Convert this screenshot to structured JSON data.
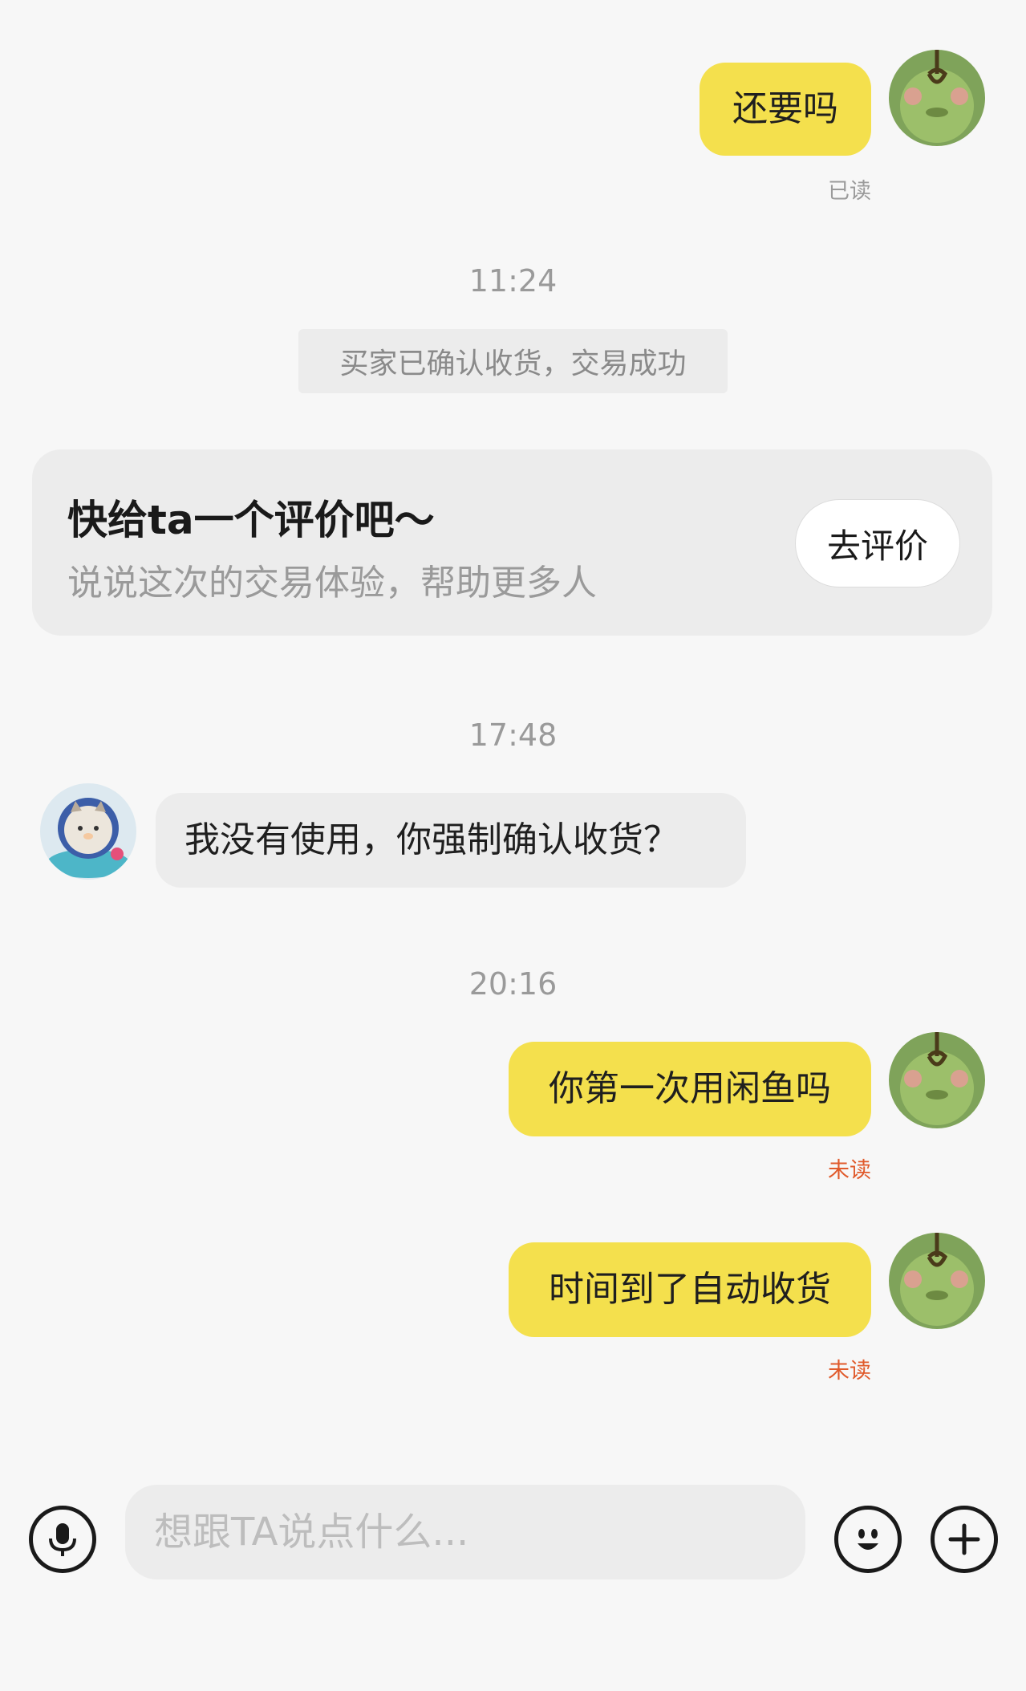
{
  "messages": [
    {
      "text": "还要吗",
      "status": "已读"
    },
    {
      "time": "11:24"
    },
    {
      "system_notice": "买家已确认收货，交易成功"
    },
    {
      "time": "17:48"
    },
    {
      "text": "我没有使用，你强制确认收货？"
    },
    {
      "time": "20:16"
    },
    {
      "text": "你第一次用闲鱼吗",
      "status": "未读"
    },
    {
      "text": "时间到了自动收货",
      "status": "未读"
    }
  ],
  "review_card": {
    "title": "快给ta一个评价吧～",
    "subtitle": "说说这次的交易体验，帮助更多人",
    "button": "去评价"
  },
  "input": {
    "placeholder": "想跟TA说点什么..."
  },
  "icons": {
    "voice": "microphone-icon",
    "emoji": "smiley-icon",
    "more": "plus-icon"
  },
  "colors": {
    "my_bubble": "#f4e04d",
    "their_bubble": "#ececec",
    "unread": "#e05a2b",
    "read": "#9a9a9a",
    "background": "#f7f7f7"
  }
}
